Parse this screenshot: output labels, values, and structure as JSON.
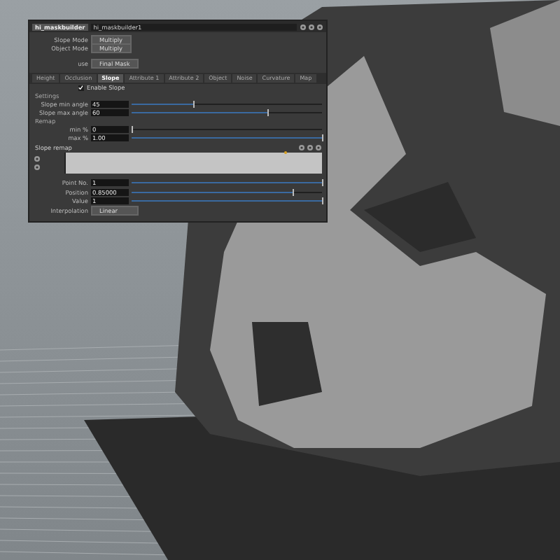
{
  "panel": {
    "title": "hi_maskbuilder",
    "path": "hi_maskbuilder1",
    "modes": [
      {
        "label": "Slope Mode",
        "value": "Multiply"
      },
      {
        "label": "Object Mode",
        "value": "Multiply"
      }
    ],
    "use": {
      "label": "use",
      "value": "Final Mask"
    },
    "tabs": [
      {
        "label": "Height",
        "selected": false
      },
      {
        "label": "Occlusion",
        "selected": false
      },
      {
        "label": "Slope",
        "selected": true
      },
      {
        "label": "Attribute 1",
        "selected": false
      },
      {
        "label": "Attribute 2",
        "selected": false
      },
      {
        "label": "Object",
        "selected": false
      },
      {
        "label": "Noise",
        "selected": false
      },
      {
        "label": "Curvature",
        "selected": false
      },
      {
        "label": "Map",
        "selected": false
      }
    ],
    "enable": {
      "label": "Enable Slope",
      "checked": true
    },
    "settings": {
      "heading": "Settings",
      "rows": [
        {
          "label": "Slope min angle",
          "value": "45",
          "level": 0.33
        },
        {
          "label": "Slope max angle",
          "value": "60",
          "level": 0.72
        }
      ]
    },
    "remap": {
      "heading": "Remap",
      "rows": [
        {
          "label": "min %",
          "value": "0",
          "level": 0
        },
        {
          "label": "max %",
          "value": "1.00",
          "level": 1
        }
      ]
    },
    "ramp": {
      "heading": "Slope remap",
      "rows": [
        {
          "label": "Point No.",
          "value": "1",
          "level": 1
        },
        {
          "label": "Position",
          "value": "0.85000",
          "level": 0.85
        },
        {
          "label": "Value",
          "value": "1",
          "level": 1
        }
      ],
      "interpolation": {
        "label": "Interpolation",
        "value": "Linear"
      }
    }
  }
}
